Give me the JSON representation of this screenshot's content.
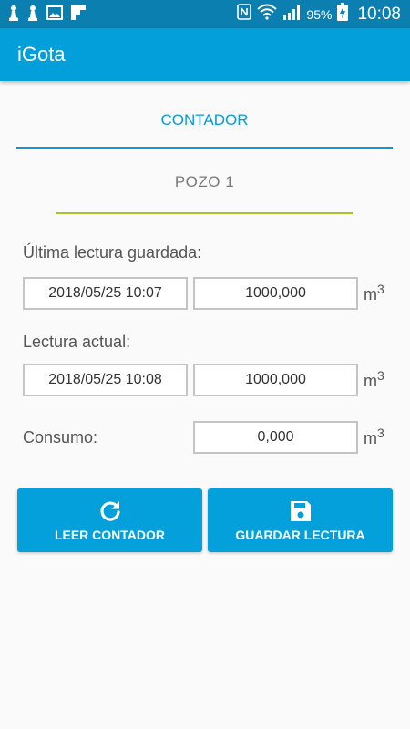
{
  "status_bar": {
    "battery_percent": "95%",
    "time": "10:08",
    "icons": [
      "chess-pawn-icon",
      "chess-pawn-icon",
      "image-icon",
      "flipboard-icon",
      "nfc-icon",
      "wifi-icon",
      "signal-icon",
      "battery-charging-icon"
    ]
  },
  "app": {
    "title": "iGota"
  },
  "tabs": {
    "active_label": "CONTADOR"
  },
  "well": {
    "label": "POZO 1"
  },
  "last_reading": {
    "label": "Última lectura guardada:",
    "date": "2018/05/25 10:07",
    "value": "1000,000",
    "unit": "m",
    "unit_exp": "3"
  },
  "current_reading": {
    "label": "Lectura actual:",
    "date": "2018/05/25 10:08",
    "value": "1000,000",
    "unit": "m",
    "unit_exp": "3"
  },
  "consumption": {
    "label": "Consumo:",
    "value": "0,000",
    "unit": "m",
    "unit_exp": "3"
  },
  "buttons": {
    "read_label": "LEER CONTADOR",
    "read_icon": "refresh-icon",
    "save_label": "GUARDAR LECTURA",
    "save_icon": "floppy-disk-icon"
  },
  "colors": {
    "status_bar": "#0b7fb0",
    "app_bar": "#039fdb",
    "accent": "#079bd6",
    "pozo_underline": "#a9c22a",
    "button": "#03a0dc"
  }
}
